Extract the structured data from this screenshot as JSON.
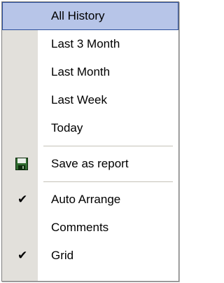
{
  "menu": {
    "items": [
      {
        "label": "All History",
        "selected": true
      },
      {
        "label": "Last 3 Month"
      },
      {
        "label": "Last Month"
      },
      {
        "label": "Last Week"
      },
      {
        "label": "Today"
      },
      {
        "label": "Save as report",
        "icon": "floppy-disk-icon"
      },
      {
        "label": "Auto Arrange",
        "checked": true
      },
      {
        "label": "Comments"
      },
      {
        "label": "Grid",
        "checked": true
      }
    ],
    "check_glyph": "✔",
    "colors": {
      "highlight_fill": "#b7c5e8",
      "highlight_border": "#2b4f9c",
      "gutter": "#e2e0db",
      "icon_green": "#2f6b2f"
    }
  }
}
